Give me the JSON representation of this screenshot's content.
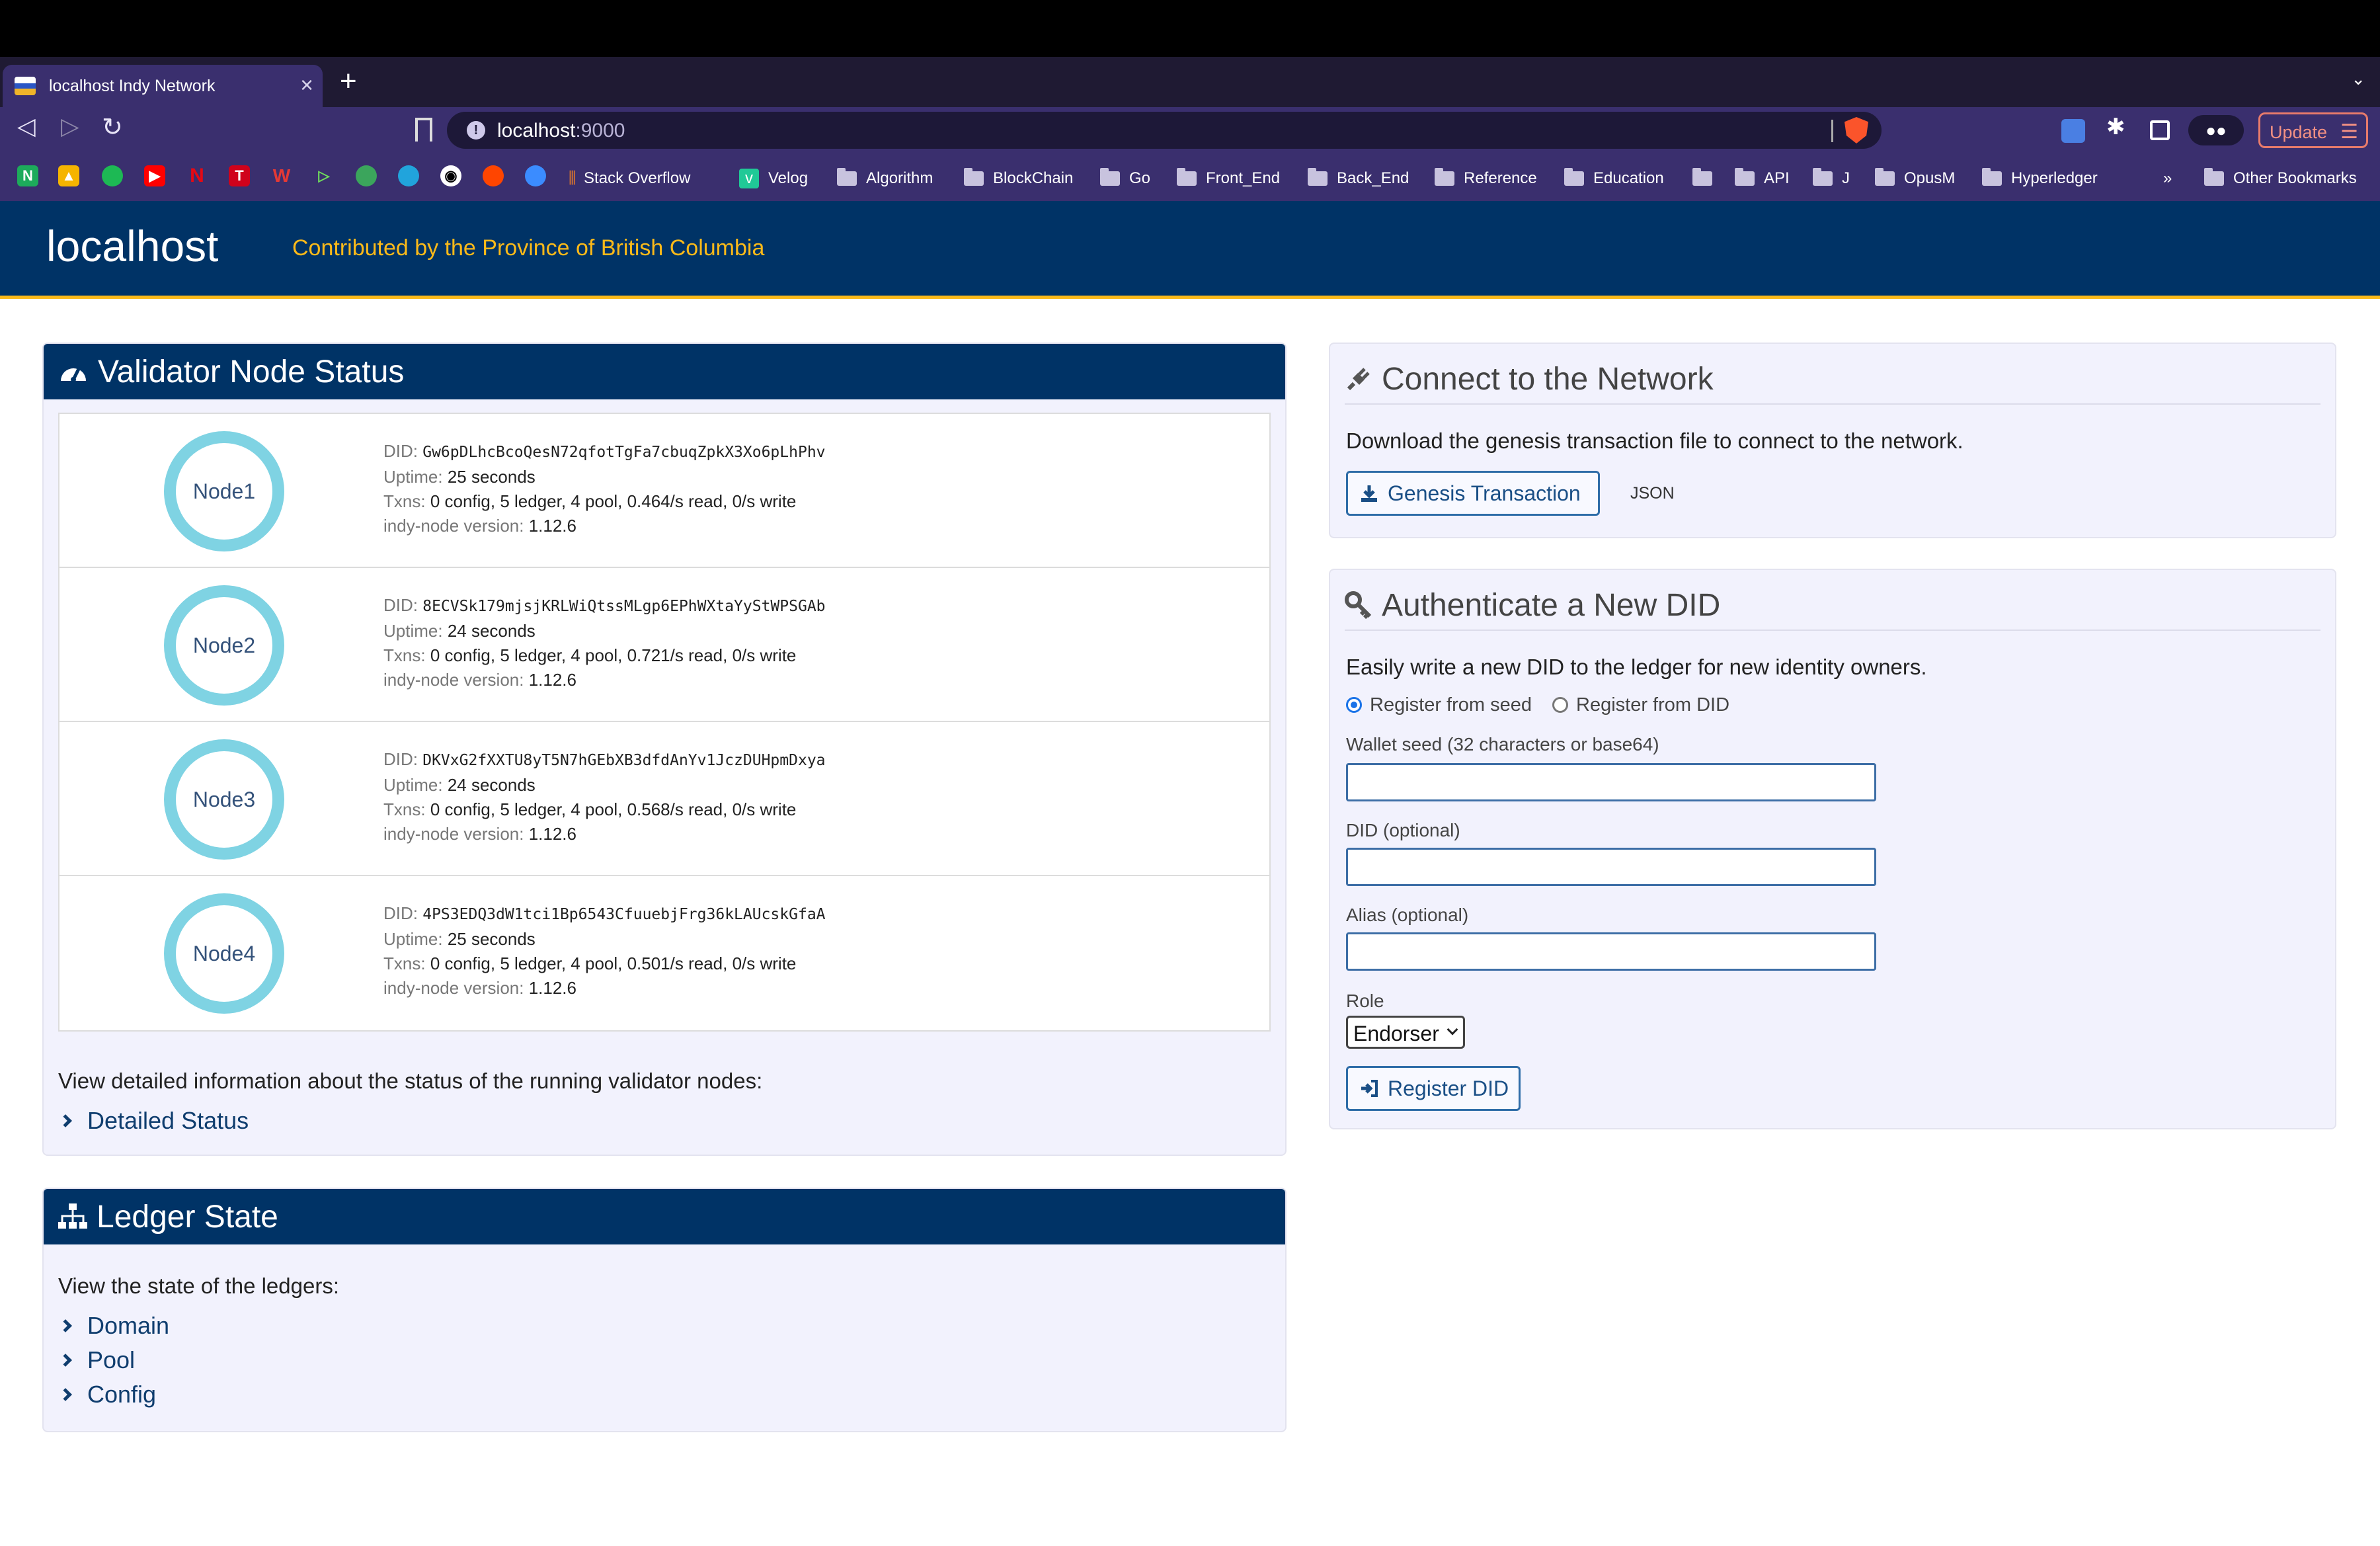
{
  "browser": {
    "tab_title": "localhost Indy Network",
    "url_host": "localhost",
    "url_port": ":9000",
    "update_label": "Update",
    "bookmarks": [
      "Stack Overflow",
      "Velog",
      "Algorithm",
      "BlockChain",
      "Go",
      "Front_End",
      "Back_End",
      "Reference",
      "Education",
      "",
      "API",
      "J",
      "OpusM",
      "Hyperledger"
    ],
    "other_bookmarks": "Other Bookmarks",
    "overflow": "»"
  },
  "header": {
    "title": "localhost",
    "subtitle": "Contributed by the Province of British Columbia"
  },
  "validator": {
    "title": "Validator Node Status",
    "labels": {
      "did": "DID:",
      "uptime": "Uptime:",
      "txns": "Txns:",
      "version": "indy-node version:"
    },
    "nodes": [
      {
        "name": "Node1",
        "did": "Gw6pDLhcBcoQesN72qfotTgFa7cbuqZpkX3Xo6pLhPhv",
        "uptime": "25 seconds",
        "txns": "0 config, 5 ledger, 4 pool, 0.464/s read, 0/s write",
        "version": "1.12.6"
      },
      {
        "name": "Node2",
        "did": "8ECVSk179mjsjKRLWiQtssMLgp6EPhWXtaYyStWPSGAb",
        "uptime": "24 seconds",
        "txns": "0 config, 5 ledger, 4 pool, 0.721/s read, 0/s write",
        "version": "1.12.6"
      },
      {
        "name": "Node3",
        "did": "DKVxG2fXXTU8yT5N7hGEbXB3dfdAnYv1JczDUHpmDxya",
        "uptime": "24 seconds",
        "txns": "0 config, 5 ledger, 4 pool, 0.568/s read, 0/s write",
        "version": "1.12.6"
      },
      {
        "name": "Node4",
        "did": "4PS3EDQ3dW1tci1Bp6543CfuuebjFrg36kLAUcskGfaA",
        "uptime": "25 seconds",
        "txns": "0 config, 5 ledger, 4 pool, 0.501/s read, 0/s write",
        "version": "1.12.6"
      }
    ],
    "detail_text": "View detailed information about the status of the running validator nodes:",
    "detail_link": "Detailed Status"
  },
  "ledger": {
    "title": "Ledger State",
    "text": "View the state of the ledgers:",
    "links": [
      "Domain",
      "Pool",
      "Config"
    ]
  },
  "connect": {
    "title": "Connect to the Network",
    "text": "Download the genesis transaction file to connect to the network.",
    "genesis_button": "Genesis Transaction",
    "json_link": "JSON"
  },
  "auth": {
    "title": "Authenticate a New DID",
    "text": "Easily write a new DID to the ledger for new identity owners.",
    "radio_seed": "Register from seed",
    "radio_did": "Register from DID",
    "seed_label": "Wallet seed (32 characters or base64)",
    "did_label": "DID (optional)",
    "alias_label": "Alias (optional)",
    "role_label": "Role",
    "role_value": "Endorser",
    "register_button": "Register DID"
  },
  "colors": {
    "header_bg": "#003366",
    "accent": "#fcba19",
    "node_ring": "#7fd3e3"
  }
}
